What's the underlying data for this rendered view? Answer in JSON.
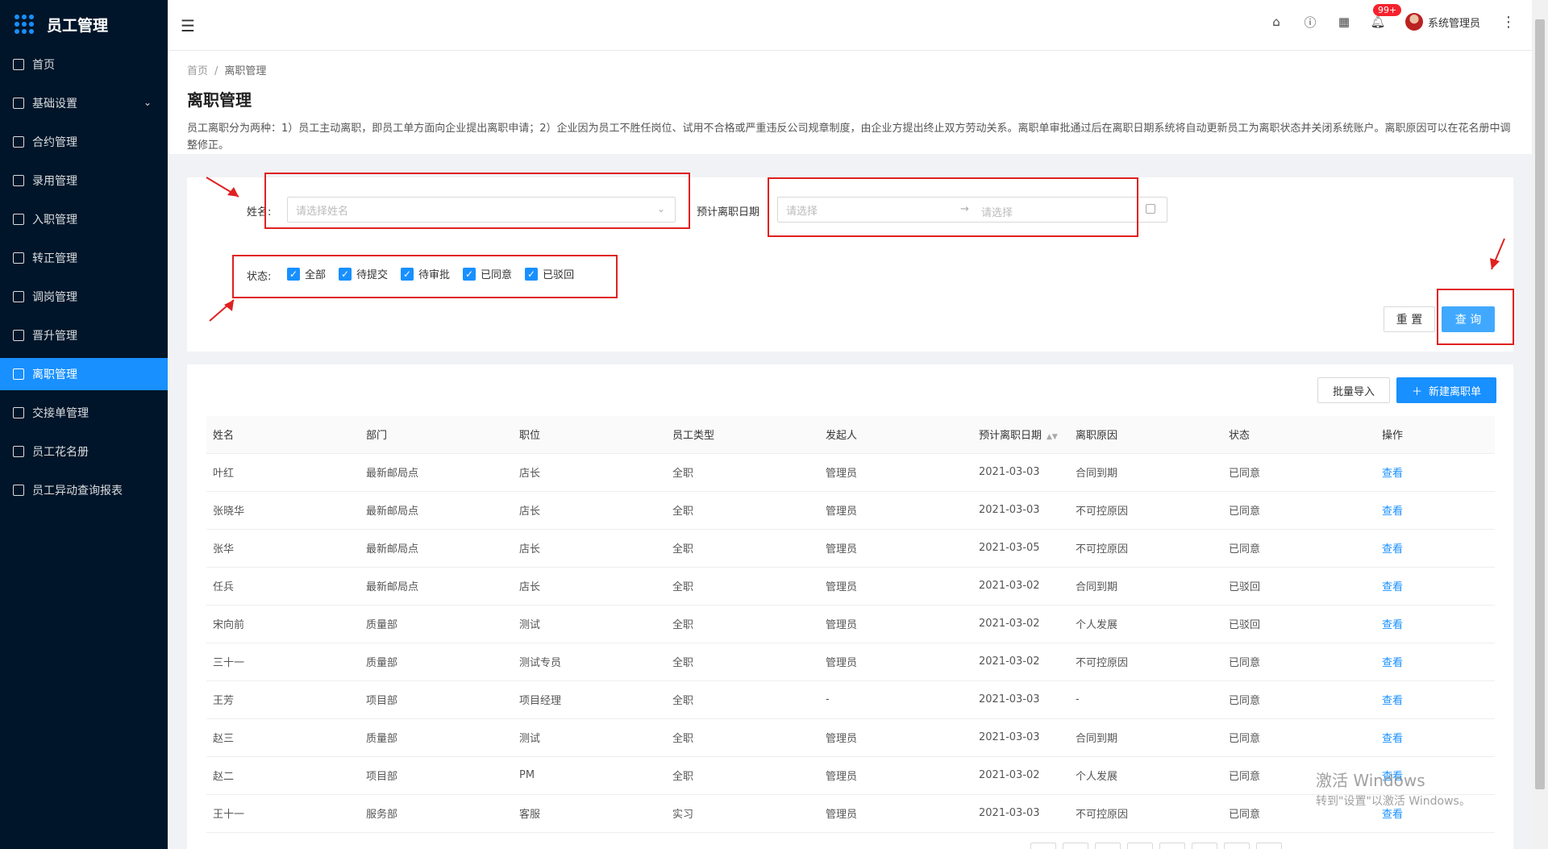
{
  "app": {
    "title": "员工管理"
  },
  "sidebar": {
    "items": [
      {
        "label": "首页"
      },
      {
        "label": "基础设置",
        "has_children": true
      },
      {
        "label": "合约管理"
      },
      {
        "label": "录用管理"
      },
      {
        "label": "入职管理"
      },
      {
        "label": "转正管理"
      },
      {
        "label": "调岗管理"
      },
      {
        "label": "晋升管理"
      },
      {
        "label": "离职管理",
        "active": true
      },
      {
        "label": "交接单管理"
      },
      {
        "label": "员工花名册"
      },
      {
        "label": "员工异动查询报表"
      }
    ]
  },
  "header": {
    "notification_badge": "99+",
    "user_name": "系统管理员"
  },
  "breadcrumb": {
    "home": "首页",
    "separator": "/",
    "current": "离职管理"
  },
  "page": {
    "title": "离职管理",
    "description": "员工离职分为两种：1）员工主动离职，即员工单方面向企业提出离职申请；2）企业因为员工不胜任岗位、试用不合格或严重违反公司规章制度，由企业方提出终止双方劳动关系。离职单审批通过后在离职日期系统将自动更新员工为离职状态并关闭系统账户。离职原因可以在花名册中调整修正。"
  },
  "filter": {
    "name_label": "姓名:",
    "name_placeholder": "请选择姓名",
    "date_label": "预计离职日期",
    "date_start_placeholder": "请选择",
    "date_end_placeholder": "请选择",
    "status_label": "状态:",
    "status_options": [
      "全部",
      "待提交",
      "待审批",
      "已同意",
      "已驳回"
    ],
    "reset_label": "重 置",
    "query_label": "查 询"
  },
  "table": {
    "import_label": "批量导入",
    "new_label": "新建离职单",
    "columns": [
      "姓名",
      "部门",
      "职位",
      "员工类型",
      "发起人",
      "预计离职日期",
      "离职原因",
      "状态",
      "操作"
    ],
    "rows": [
      [
        "叶红",
        "最新邮局点",
        "店长",
        "全职",
        "管理员",
        "2021-03-03",
        "合同到期",
        "已同意",
        "查看"
      ],
      [
        "张晓华",
        "最新邮局点",
        "店长",
        "全职",
        "管理员",
        "2021-03-03",
        "不可控原因",
        "已同意",
        "查看"
      ],
      [
        "张华",
        "最新邮局点",
        "店长",
        "全职",
        "管理员",
        "2021-03-05",
        "不可控原因",
        "已同意",
        "查看"
      ],
      [
        "任兵",
        "最新邮局点",
        "店长",
        "全职",
        "管理员",
        "2021-03-02",
        "合同到期",
        "已驳回",
        "查看"
      ],
      [
        "宋向前",
        "质量部",
        "测试",
        "全职",
        "管理员",
        "2021-03-02",
        "个人发展",
        "已驳回",
        "查看"
      ],
      [
        "三十一",
        "质量部",
        "测试专员",
        "全职",
        "管理员",
        "2021-03-02",
        "不可控原因",
        "已同意",
        "查看"
      ],
      [
        "王芳",
        "项目部",
        "项目经理",
        "全职",
        "-",
        "2021-03-03",
        "-",
        "已同意",
        "查看"
      ],
      [
        "赵三",
        "质量部",
        "测试",
        "全职",
        "管理员",
        "2021-03-03",
        "合同到期",
        "已同意",
        "查看"
      ],
      [
        "赵二",
        "项目部",
        "PM",
        "全职",
        "管理员",
        "2021-03-02",
        "个人发展",
        "已同意",
        "查看"
      ],
      [
        "王十一",
        "服务部",
        "客服",
        "实习",
        "管理员",
        "2021-03-03",
        "不可控原因",
        "已同意",
        "查看"
      ]
    ]
  },
  "watermark": {
    "line1": "激活 Windows",
    "line2": "转到\"设置\"以激活 Windows。"
  }
}
